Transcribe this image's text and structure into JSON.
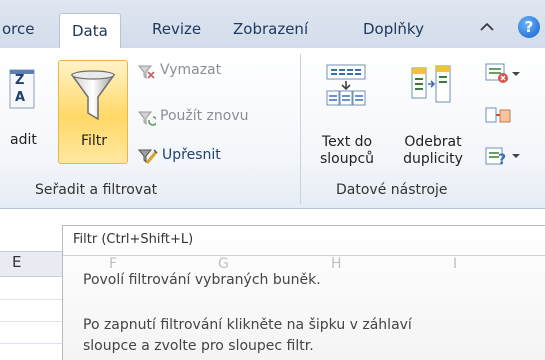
{
  "tabs": [
    {
      "label": "orce",
      "active": false
    },
    {
      "label": "Data",
      "active": true
    },
    {
      "label": "Revize",
      "active": false
    },
    {
      "label": "Zobrazení",
      "active": false
    },
    {
      "label": "Doplňky",
      "active": false
    }
  ],
  "help_glyph": "?",
  "ribbon": {
    "sort_filter_group": {
      "label": "Seřadit a filtrovat",
      "sort_partial_label": "adit",
      "sort_icon_letters": [
        "Z",
        "A"
      ],
      "filter_label": "Filtr",
      "clear_label": "Vymazat",
      "reapply_label": "Použít znovu",
      "advanced_label": "Upřesnit"
    },
    "data_tools_group": {
      "label": "Datové nástroje",
      "text_to_columns_line1": "Text do",
      "text_to_columns_line2": "sloupců",
      "remove_duplicates_line1": "Odebrat",
      "remove_duplicates_line2": "duplicity"
    }
  },
  "sheet": {
    "column_letters": [
      "E",
      "F",
      "G",
      "H",
      "I"
    ]
  },
  "tooltip": {
    "title": "Filtr (Ctrl+Shift+L)",
    "line1": "Povolí filtrování vybraných buněk.",
    "line2": "Po zapnutí filtrování klikněte na šipku v záhlaví",
    "line3": "sloupce a zvolte pro sloupec filtr."
  },
  "colors": {
    "ribbon_accent": "#ffd867",
    "tab_text": "#20395f",
    "help_blue": "#1560c8"
  }
}
